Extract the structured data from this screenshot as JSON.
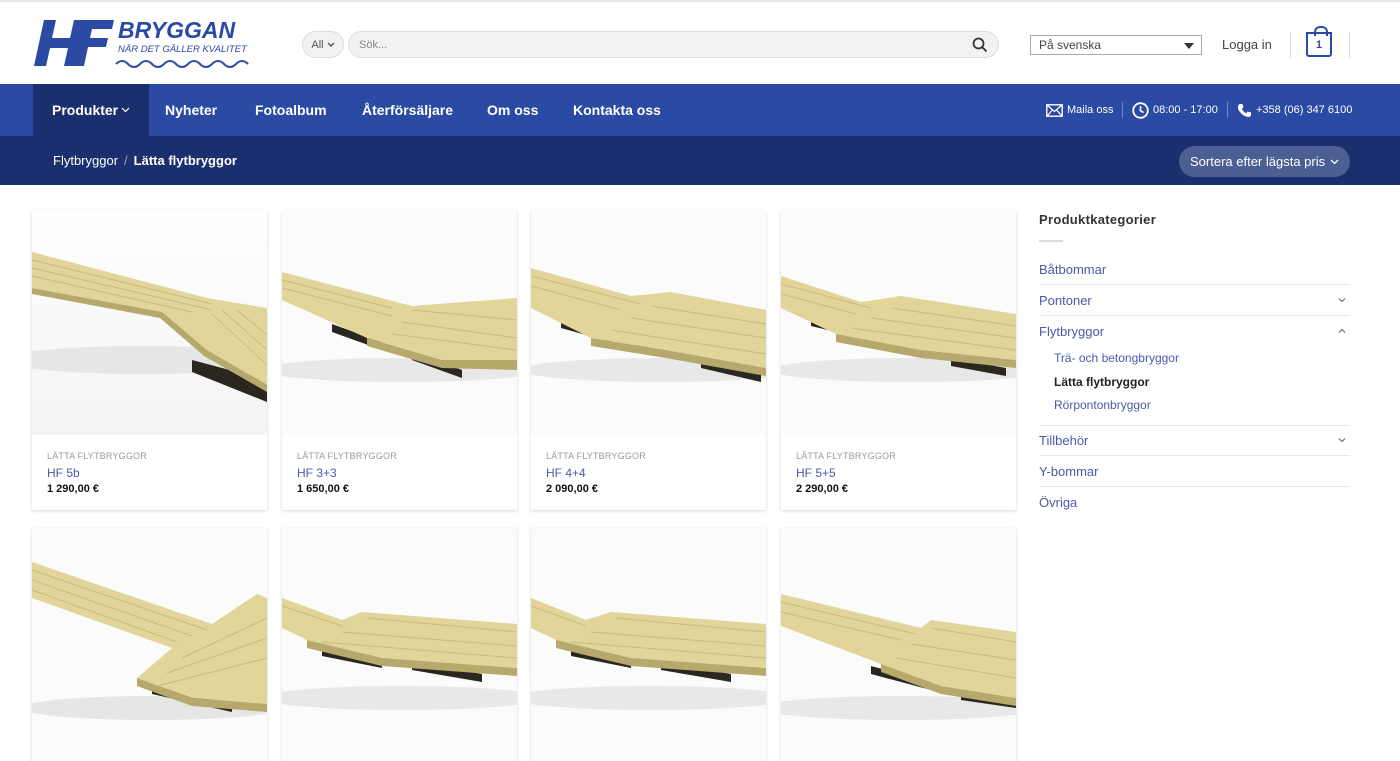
{
  "header": {
    "logo": {
      "letters": "HF",
      "brand": "BRYGGAN",
      "tagline": "NÄR DET GÄLLER KVALITET"
    },
    "search": {
      "category": "All",
      "placeholder": "Sök..."
    },
    "language": "På svenska",
    "login": "Logga in",
    "cart_count": "1"
  },
  "nav": {
    "items": [
      {
        "label": "Produkter"
      },
      {
        "label": "Nyheter"
      },
      {
        "label": "Fotoalbum"
      },
      {
        "label": "Återförsäljare"
      },
      {
        "label": "Om oss"
      },
      {
        "label": "Kontakta oss"
      }
    ],
    "contact": {
      "mail": "Maila oss",
      "hours": "08:00 - 17:00",
      "phone": "+358 (06) 347 6100"
    }
  },
  "breadcrumb": {
    "parent": "Flytbryggor",
    "separator": "/",
    "current": "Lätta flytbryggor"
  },
  "sort_label": "Sortera efter lägsta pris",
  "products": [
    {
      "category": "LÄTTA FLYTBRYGGOR",
      "name": "HF 5b",
      "price": "1 290,00 €"
    },
    {
      "category": "LÄTTA FLYTBRYGGOR",
      "name": "HF 3+3",
      "price": "1 650,00 €"
    },
    {
      "category": "LÄTTA FLYTBRYGGOR",
      "name": "HF 4+4",
      "price": "2 090,00 €"
    },
    {
      "category": "LÄTTA FLYTBRYGGOR",
      "name": "HF 5+5",
      "price": "2 290,00 €"
    }
  ],
  "sidebar": {
    "title": "Produktkategorier",
    "items": [
      {
        "label": "Båtbommar"
      },
      {
        "label": "Pontoner"
      },
      {
        "label": "Flytbryggor"
      },
      {
        "label": "Tillbehör"
      },
      {
        "label": "Y-bommar"
      },
      {
        "label": "Övriga"
      }
    ],
    "subitems": [
      {
        "label": "Trä- och betongbryggor"
      },
      {
        "label": "Lätta flytbryggor"
      },
      {
        "label": "Rörpontonbryggor"
      }
    ]
  },
  "colors": {
    "primary": "#2a4aa3",
    "dark": "#1b2f6e",
    "link": "#4a5aa8",
    "deck": "#e2d59a"
  }
}
